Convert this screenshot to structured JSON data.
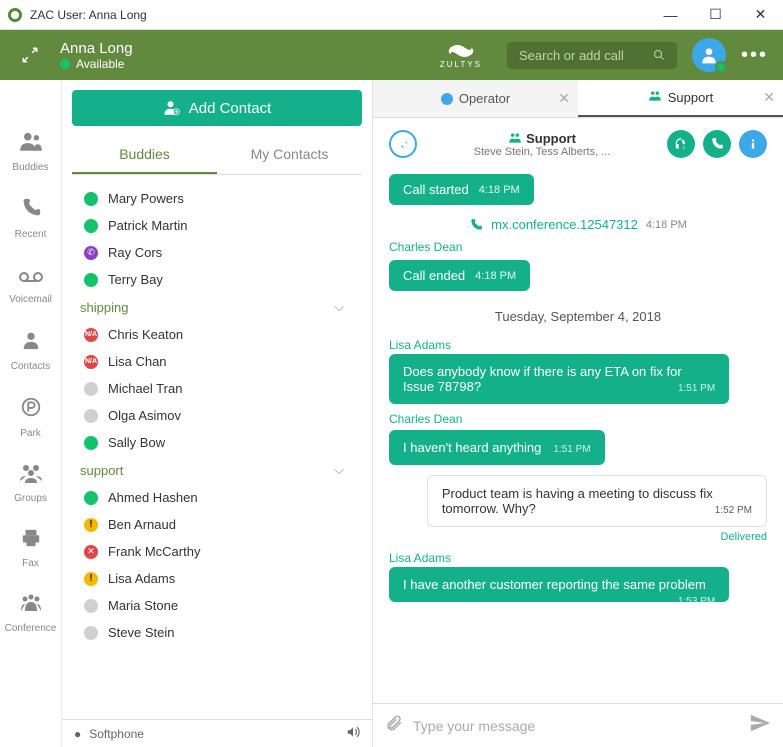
{
  "window": {
    "title": "ZAC User: Anna Long"
  },
  "header": {
    "name": "Anna Long",
    "status": "Available",
    "logo_text": "ZULTYS",
    "search_placeholder": "Search or add call"
  },
  "sidebar": {
    "items": [
      {
        "label": "Buddies"
      },
      {
        "label": "Recent"
      },
      {
        "label": "Voicemail"
      },
      {
        "label": "Contacts"
      },
      {
        "label": "Park"
      },
      {
        "label": "Groups"
      },
      {
        "label": "Fax"
      },
      {
        "label": "Conference"
      }
    ]
  },
  "leftpanel": {
    "add_contact": "Add Contact",
    "tab_buddies": "Buddies",
    "tab_mycontacts": "My Contacts",
    "softphone": "Softphone",
    "buddies": [
      {
        "name": "Mary Powers",
        "p": "avail"
      },
      {
        "name": "Patrick Martin",
        "p": "avail"
      },
      {
        "name": "Ray Cors",
        "p": "viber"
      },
      {
        "name": "Terry Bay",
        "p": "avail"
      }
    ],
    "group1": "shipping",
    "group1_items": [
      {
        "name": "Chris Keaton",
        "p": "na"
      },
      {
        "name": "Lisa Chan",
        "p": "na"
      },
      {
        "name": "Michael Tran",
        "p": "offline"
      },
      {
        "name": "Olga Asimov",
        "p": "offline"
      },
      {
        "name": "Sally Bow",
        "p": "avail"
      }
    ],
    "group2": "support",
    "group2_items": [
      {
        "name": "Ahmed Hashen",
        "p": "avail"
      },
      {
        "name": "Ben Arnaud",
        "p": "warn"
      },
      {
        "name": "Frank McCarthy",
        "p": "busy"
      },
      {
        "name": "Lisa Adams",
        "p": "warn"
      },
      {
        "name": "Maria Stone",
        "p": "offline"
      },
      {
        "name": "Steve Stein",
        "p": "offline"
      }
    ]
  },
  "chat": {
    "tab_operator": "Operator",
    "tab_support": "Support",
    "header_title": "Support",
    "header_subtitle": "Steve Stein, Tess Alberts, ...",
    "call_started": "Call started",
    "call_started_time": "4:18 PM",
    "conference_id": "mx.conference.12547312",
    "conference_time": "4:18 PM",
    "sender_charles1": "Charles Dean",
    "call_ended": "Call ended",
    "call_ended_time": "4:18 PM",
    "date_divider": "Tuesday, September 4, 2018",
    "sender_lisa1": "Lisa Adams",
    "msg1": "Does anybody know if there is any ETA on fix for Issue 78798?",
    "msg1_time": "1:51 PM",
    "sender_charles2": "Charles Dean",
    "msg2": "I haven't heard anything",
    "msg2_time": "1:51 PM",
    "msg3": "Product team is having a meeting to discuss fix tomorrow. Why?",
    "msg3_time": "1:52 PM",
    "delivered": "Delivered",
    "sender_lisa2": "Lisa Adams",
    "msg4": "I have another customer reporting the same problem",
    "msg4_time": "1:53 PM",
    "composer_placeholder": "Type your message"
  }
}
